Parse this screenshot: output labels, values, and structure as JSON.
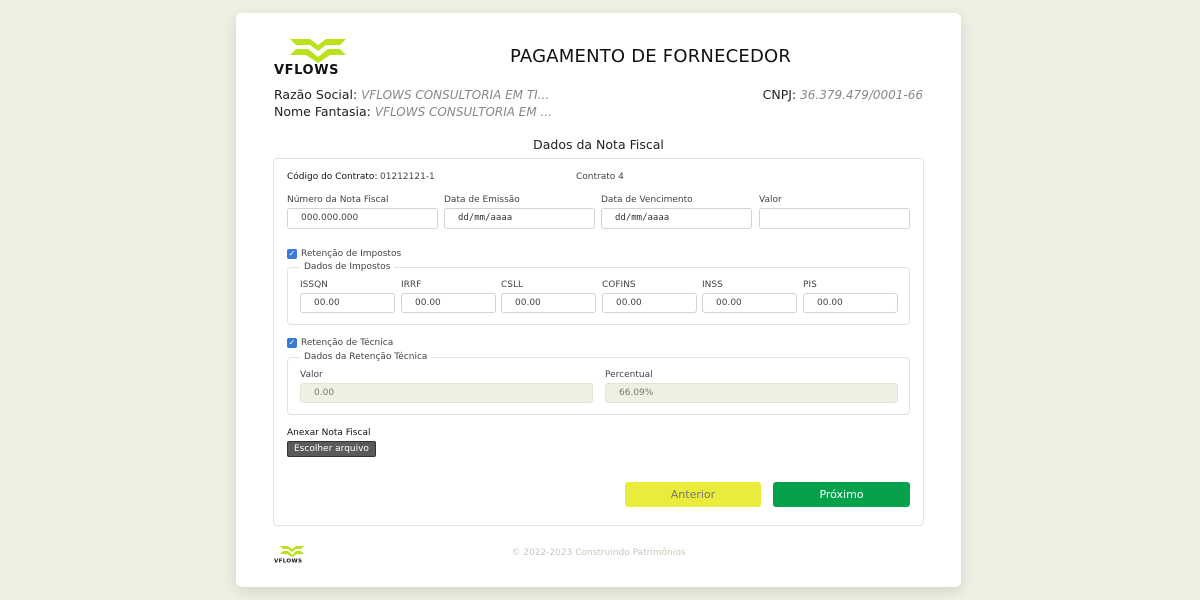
{
  "brand": {
    "logo_text": "VFLOWS",
    "accent": "#b9e21b"
  },
  "page": {
    "title": "PAGAMENTO DE FORNECEDOR"
  },
  "company": {
    "razao_label": "Razão Social:",
    "razao_value": "VFLOWS CONSULTORIA EM TI...",
    "fantasia_label": "Nome Fantasia:",
    "fantasia_value": "VFLOWS CONSULTORIA EM ...",
    "cnpj_label": "CNPJ:",
    "cnpj_value": "36.379.479/0001-66"
  },
  "section": {
    "title": "Dados da Nota Fiscal"
  },
  "contract": {
    "label": "Código do Contrato:",
    "code": "01212121-1",
    "name": "Contrato 4"
  },
  "invoice": {
    "numero_label": "Número da Nota Fiscal",
    "numero_placeholder": "000.000.000",
    "emissao_label": "Data de Emissão",
    "emissao_value": "dd/mm/aaaa",
    "vencimento_label": "Data de Vencimento",
    "vencimento_value": "dd/mm/aaaa",
    "valor_label": "Valor",
    "valor_value": ""
  },
  "taxes": {
    "checkbox_label": "Retenção de Impostos",
    "checked": true,
    "legend": "Dados de Impostos",
    "fields": [
      {
        "label": "ISSQN",
        "value": "00.00"
      },
      {
        "label": "IRRF",
        "value": "00.00"
      },
      {
        "label": "CSLL",
        "value": "00.00"
      },
      {
        "label": "COFINS",
        "value": "00.00"
      },
      {
        "label": "INSS",
        "value": "00.00"
      },
      {
        "label": "PIS",
        "value": "00.00"
      }
    ]
  },
  "technical": {
    "checkbox_label": "Retenção de Técnica",
    "checked": true,
    "legend": "Dados da Retenção Técnica",
    "valor_label": "Valor",
    "valor_value": "0.00",
    "percentual_label": "Percentual",
    "percentual_value": "66.09%"
  },
  "attachment": {
    "label": "Anexar Nota Fiscal",
    "button": "Escolher arquivo"
  },
  "actions": {
    "prev": "Anterior",
    "next": "Próximo",
    "prev_color": "#e9ec3a",
    "next_color": "#05a14b"
  },
  "footer": {
    "copyright": "© 2022-2023 Construindo Patrimônios"
  }
}
